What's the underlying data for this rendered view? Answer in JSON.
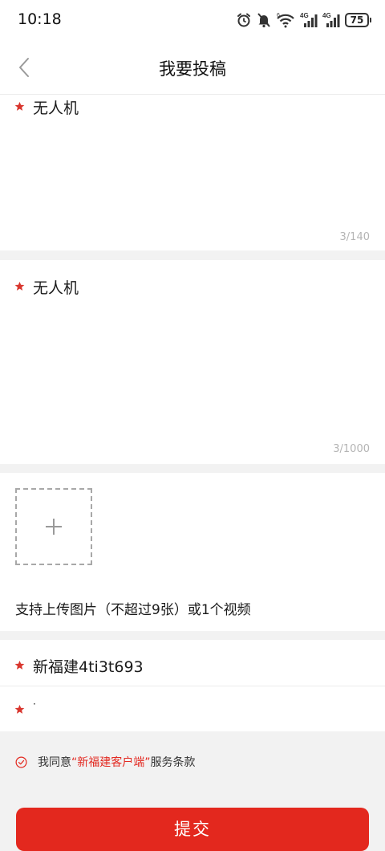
{
  "status_bar": {
    "time": "10:18",
    "battery_level": "75",
    "icons": [
      "alarm-icon",
      "mute-icon",
      "wifi-icon",
      "signal-4g-icon",
      "signal-4g-icon",
      "battery-icon"
    ],
    "wifi_badge": "6",
    "network_label_1": "4G",
    "network_label_2": "4G"
  },
  "nav": {
    "title": "我要投稿",
    "back_icon": "chevron-left-icon"
  },
  "form": {
    "title_field": {
      "value": "无人机",
      "counter": "3/140"
    },
    "content_field": {
      "value": "无人机",
      "counter": "3/1000"
    },
    "media": {
      "add_icon": "plus-icon",
      "hint": "支持上传图片（不超过9张）或1个视频"
    },
    "name_field": {
      "value": "新福建4ti3t693"
    },
    "contact_field": {
      "value": "·"
    }
  },
  "agreement": {
    "prefix": "我同意",
    "brand": "“新福建客户端”",
    "suffix": "服务条款"
  },
  "submit": {
    "label": "提交"
  },
  "colors": {
    "accent": "#e3281e",
    "required_star": "#d9362e",
    "counter_text": "#b4b4b4",
    "page_background": "#f2f2f2"
  }
}
